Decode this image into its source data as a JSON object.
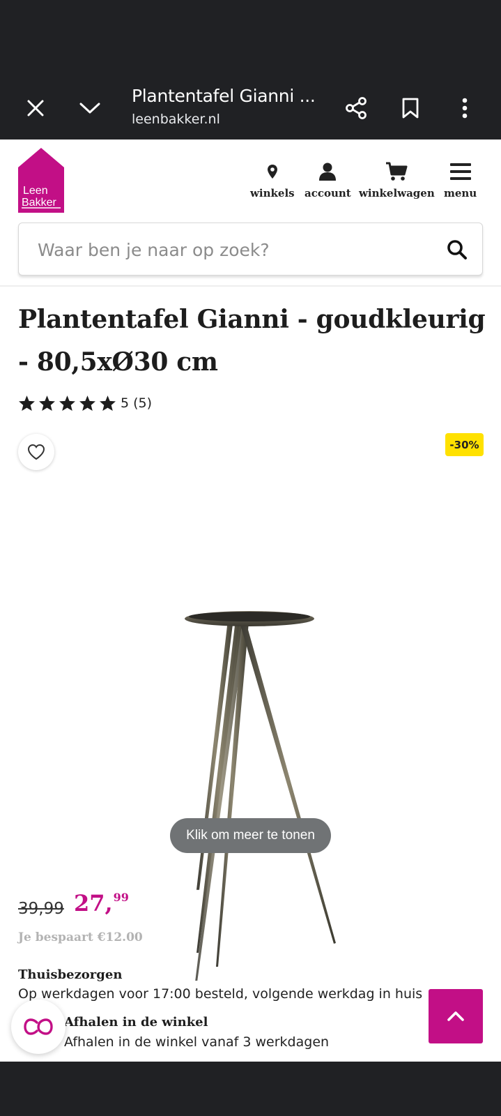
{
  "browser": {
    "title": "Plantentafel Gianni ...",
    "url": "leenbakker.nl"
  },
  "logo": {
    "line1": "Leen",
    "line2": "Bakker"
  },
  "nav": {
    "stores": "winkels",
    "account": "account",
    "cart": "winkelwagen",
    "menu": "menu"
  },
  "search": {
    "placeholder": "Waar ben je naar op zoek?"
  },
  "product": {
    "title": "Plantentafel Gianni - goudkleurig - 80,5xØ30 cm",
    "rating_value": 5,
    "rating_text": "5 (5)",
    "discount_badge": "-30%",
    "more_button": "Klik om meer te tonen",
    "old_price": "39,99",
    "price_main": "27,",
    "price_cents": "99",
    "saving": "Je bespaart €12.00"
  },
  "delivery": {
    "home_title": "Thuisbezorgen",
    "home_text": "Op werkdagen voor 17:00 besteld, volgende werkdag in huis",
    "store_title": "Afhalen in de winkel",
    "store_text": "Afhalen in de winkel vanaf 3 werkdagen"
  },
  "colors": {
    "brand": "#c20f86",
    "badge": "#ffe100",
    "chrome": "#202124"
  }
}
